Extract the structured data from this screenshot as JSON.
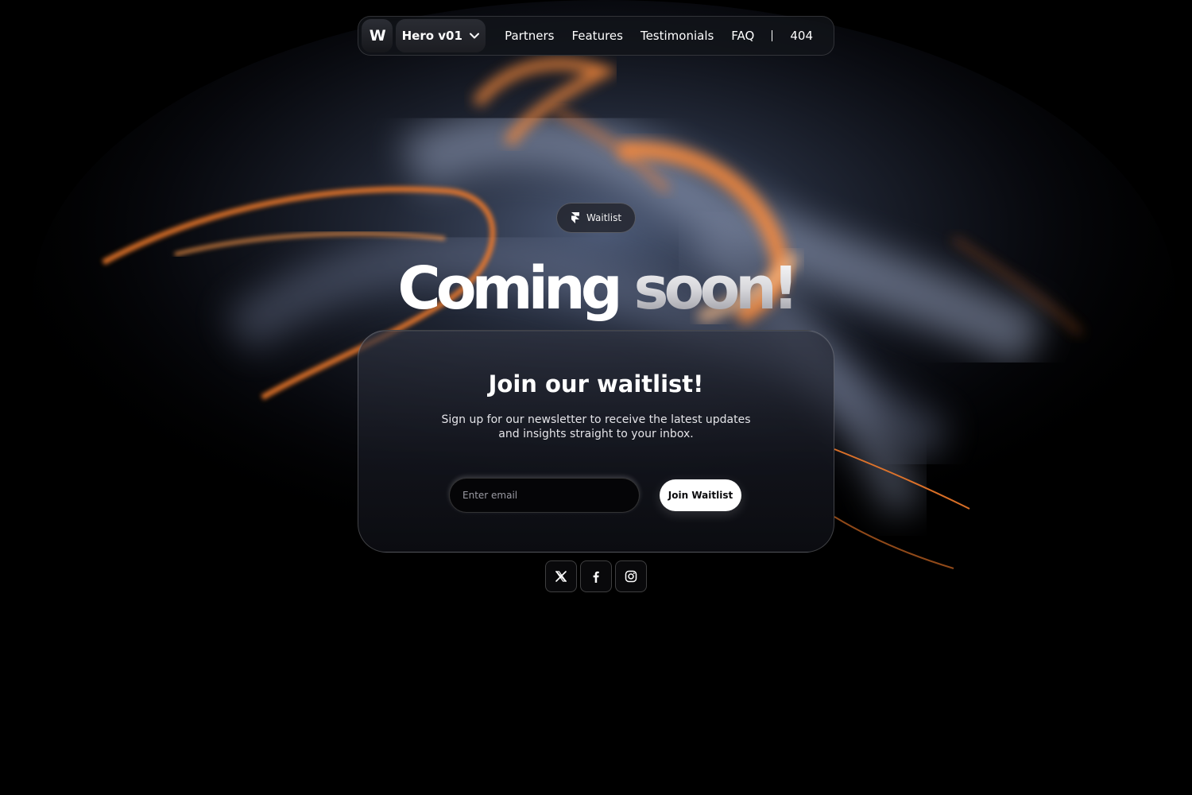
{
  "nav": {
    "logo_text": "W",
    "version_label": "Hero v01",
    "links": [
      "Partners",
      "Features",
      "Testimonials",
      "FAQ"
    ],
    "extra_link": "404"
  },
  "badge": {
    "label": "Waitlist",
    "icon": "framer-icon"
  },
  "headline": {
    "word1": "Coming",
    "word2": "soon!"
  },
  "card": {
    "title": "Join our waitlist!",
    "subtitle": "Sign up for our newsletter to receive the latest updates and insights straight to your inbox.",
    "email_placeholder": "Enter email",
    "email_value": "",
    "submit_label": "Join Waitlist"
  },
  "socials": [
    "x-icon",
    "facebook-icon",
    "instagram-icon"
  ],
  "colors": {
    "accent_orange": "#f07a2a",
    "background": "#000000",
    "button_bg": "#ffffff"
  }
}
